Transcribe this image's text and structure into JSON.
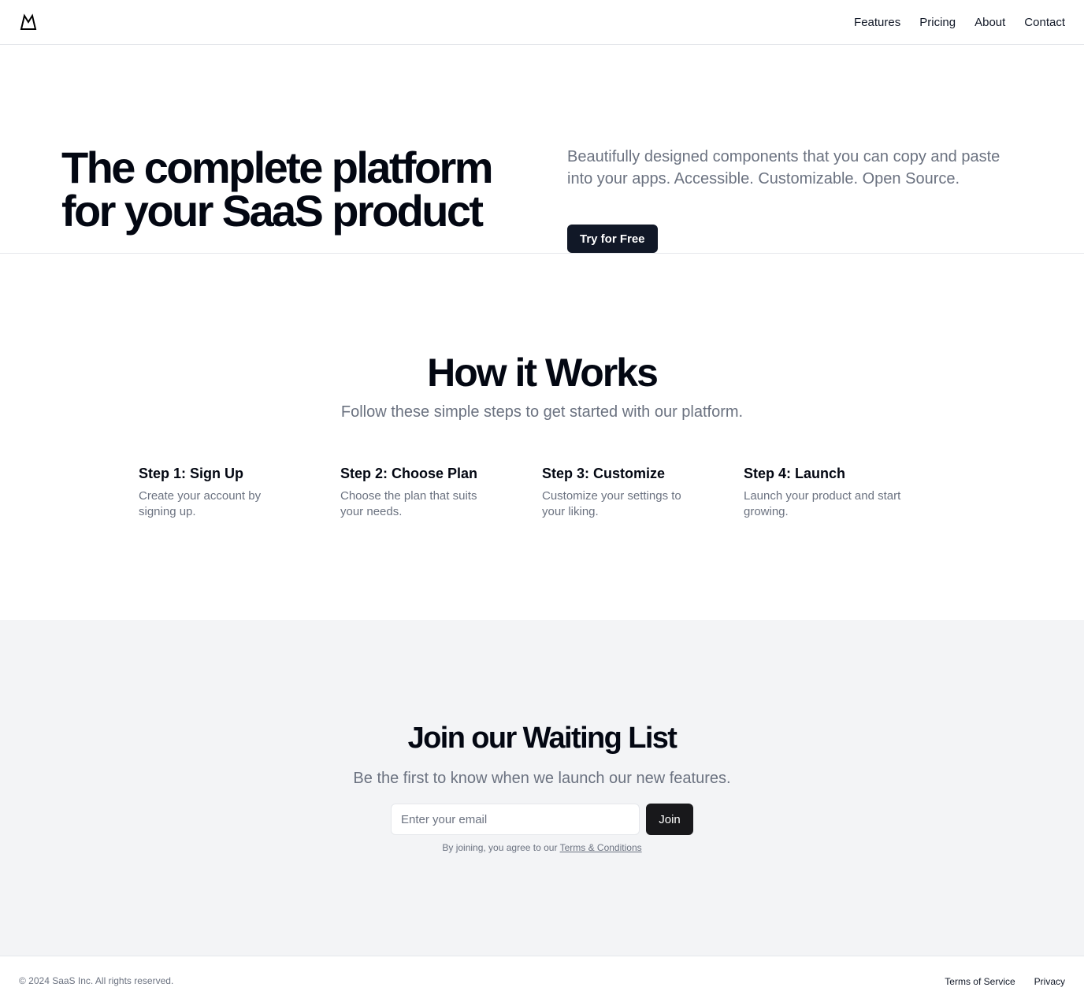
{
  "header": {
    "logo_icon": "mountain-icon",
    "nav": [
      {
        "label": "Features"
      },
      {
        "label": "Pricing"
      },
      {
        "label": "About"
      },
      {
        "label": "Contact"
      }
    ]
  },
  "hero": {
    "title": "The complete platform for your SaaS product",
    "description": "Beautifully designed components that you can copy and paste into your apps. Accessible. Customizable. Open Source.",
    "cta_label": "Try for Free"
  },
  "how_it_works": {
    "title": "How it Works",
    "subtitle": "Follow these simple steps to get started with our platform.",
    "steps": [
      {
        "title": "Step 1: Sign Up",
        "description": "Create your account by signing up."
      },
      {
        "title": "Step 2: Choose Plan",
        "description": "Choose the plan that suits your needs."
      },
      {
        "title": "Step 3: Customize",
        "description": "Customize your settings to your liking."
      },
      {
        "title": "Step 4: Launch",
        "description": "Launch your product and start growing."
      }
    ]
  },
  "waitlist": {
    "title": "Join our Waiting List",
    "subtitle": "Be the first to know when we launch our new features.",
    "email_placeholder": "Enter your email",
    "email_value": "",
    "join_label": "Join",
    "terms_prefix": "By joining, you agree to our",
    "terms_link": "Terms & Conditions"
  },
  "footer": {
    "copyright": "© 2024 SaaS Inc. All rights reserved.",
    "links": [
      {
        "label": "Terms of Service"
      },
      {
        "label": "Privacy"
      }
    ]
  },
  "colors": {
    "primary_button": "#111827",
    "join_button": "#18181b",
    "muted_text": "#6b7280",
    "waitlist_background": "#f3f4f6",
    "border": "#e5e7eb"
  }
}
